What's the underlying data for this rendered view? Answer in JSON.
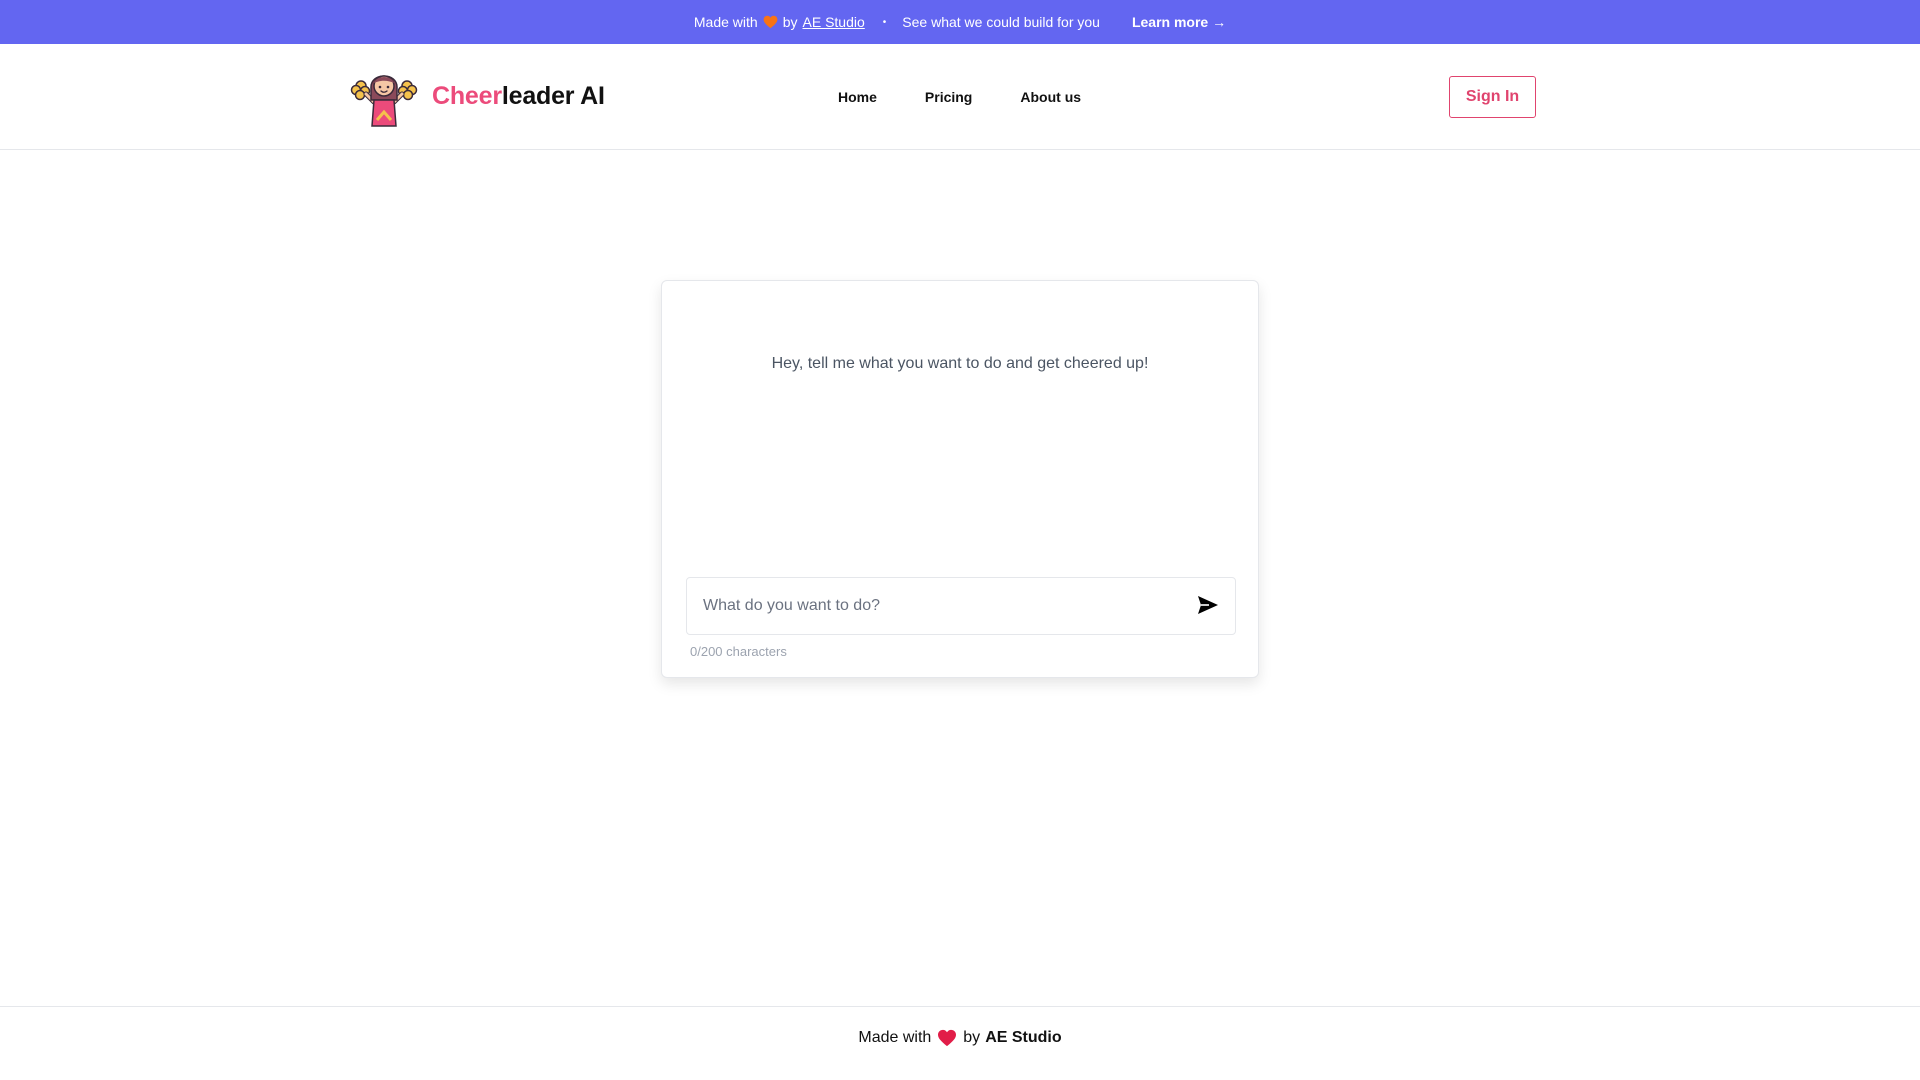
{
  "banner": {
    "made_with": "Made with",
    "by": "by",
    "studio_link": "AE Studio",
    "separator": "•",
    "tagline": "See what we could build for you",
    "learn_more": "Learn more →",
    "background_color": "#6366f1",
    "heart_color": "#f97316"
  },
  "header": {
    "brand_accent": "Cheer",
    "brand_rest": "leader AI",
    "brand_accent_color": "#ec4b7b",
    "logo_icon": "cheerleader-mascot-icon",
    "nav": [
      {
        "label": "Home"
      },
      {
        "label": "Pricing"
      },
      {
        "label": "About us"
      }
    ],
    "sign_in": "Sign In"
  },
  "chat": {
    "greeting": "Hey, tell me what you want to do and get cheered up!",
    "input_placeholder": "What do you want to do?",
    "input_value": "",
    "send_icon": "send-icon",
    "char_count": "0/200 characters"
  },
  "footer": {
    "made_with": "Made with",
    "by": "by",
    "studio": "AE Studio",
    "heart_color": "#e11d48"
  }
}
